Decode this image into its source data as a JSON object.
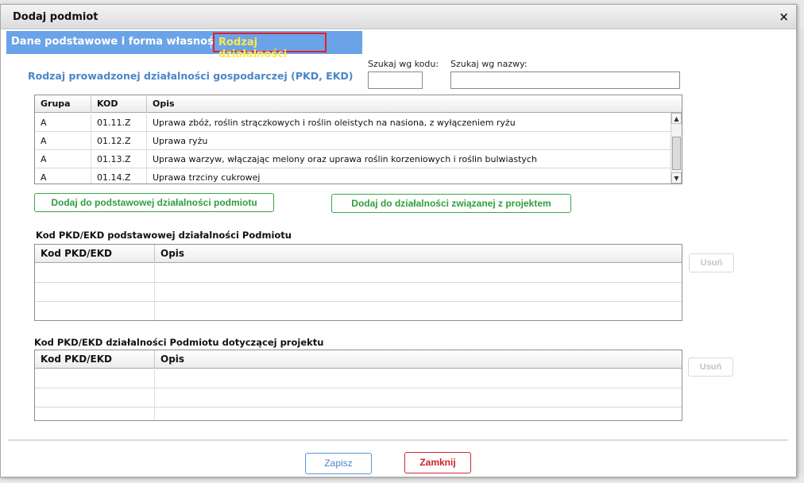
{
  "dialog": {
    "title": "Dodaj podmiot",
    "close_glyph": "×",
    "close_icon": "close-icon"
  },
  "tabs": [
    {
      "label": "Dane podstawowe i forma własności",
      "active": false
    },
    {
      "label": "Rodzaj działalności",
      "active": true
    }
  ],
  "section_title": "Rodzaj prowadzonej działalności gospodarczej (PKD, EKD)",
  "search": {
    "by_code_label": "Szukaj wg kodu:",
    "by_code_value": "",
    "by_name_label": "Szukaj wg nazwy:",
    "by_name_value": ""
  },
  "pkd_table": {
    "columns": [
      "Grupa",
      "KOD",
      "Opis"
    ],
    "rows": [
      [
        "A",
        "01.11.Z",
        "Uprawa zbóż, roślin strączkowych i roślin oleistych na nasiona, z wyłączeniem ryżu"
      ],
      [
        "A",
        "01.12.Z",
        "Uprawa ryżu"
      ],
      [
        "A",
        "01.13.Z",
        "Uprawa warzyw, włączając melony oraz uprawa roślin korzeniowych i roślin bulwiastych"
      ],
      [
        "A",
        "01.14.Z",
        "Uprawa trzciny cukrowej"
      ]
    ],
    "scroll_up": "▲",
    "scroll_down": "▼"
  },
  "actions": {
    "add_primary": "Dodaj do podstawowej działalności podmiotu",
    "add_project": "Dodaj do działalności związanej z projektem"
  },
  "primary_section": {
    "title": "Kod PKD/EKD podstawowej działalności Podmiotu",
    "columns": [
      "Kod PKD/EKD",
      "Opis"
    ],
    "remove_label": "Usuń"
  },
  "project_section": {
    "title": "Kod PKD/EKD działalności Podmiotu dotyczącej projektu",
    "columns": [
      "Kod PKD/EKD",
      "Opis"
    ],
    "remove_label": "Usuń"
  },
  "footer": {
    "save": "Zapisz",
    "close": "Zamknij"
  },
  "colors": {
    "tab_bar": "#6aa3e8",
    "active_tab_text": "#ffe94a",
    "active_tab_border": "#e0202c",
    "section_title": "#4a86c8",
    "green_button": "#2f9e3f",
    "close_button": "#c9222b"
  }
}
